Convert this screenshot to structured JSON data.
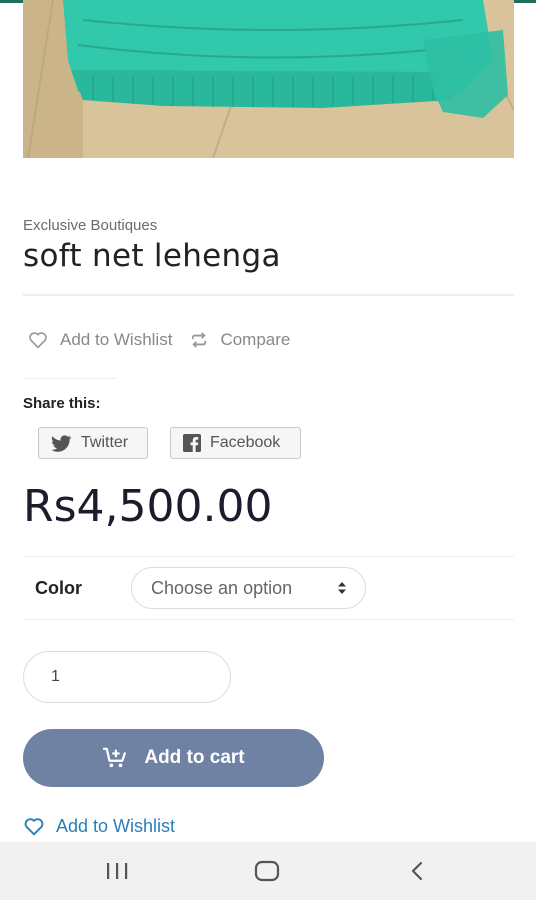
{
  "product": {
    "brand": "Exclusive Boutiques",
    "title": "soft net lehenga",
    "price": "Rs4,500.00"
  },
  "actions": {
    "wishlist_label": "Add to Wishlist",
    "compare_label": "Compare"
  },
  "share": {
    "label": "Share this:",
    "twitter_label": "Twitter",
    "facebook_label": "Facebook"
  },
  "variation": {
    "color_label": "Color",
    "color_selected": "Choose an option"
  },
  "cart": {
    "quantity": "1",
    "add_to_cart_label": "Add to cart",
    "wishlist_link_label": "Add to Wishlist"
  },
  "colors": {
    "accent_button": "#6f82a3",
    "link": "#2a7fb8",
    "lehenga": "#2fc3a6",
    "nav_bar": "#f1f1f1"
  },
  "icons": {
    "wishlist": "heart-icon",
    "compare": "compare-arrows-icon",
    "twitter": "twitter-bird-icon",
    "facebook": "facebook-icon",
    "cart": "cart-plus-icon",
    "nav_recents": "recents-icon",
    "nav_home": "home-icon",
    "nav_back": "back-icon"
  }
}
